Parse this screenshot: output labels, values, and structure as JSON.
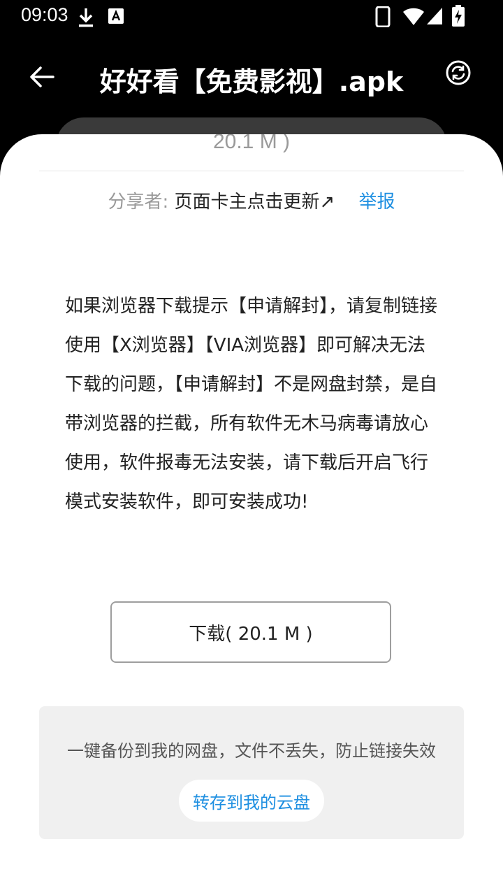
{
  "status_bar": {
    "time": "09:03",
    "icons": [
      "download-icon",
      "font-a-icon",
      "phone-icon",
      "wifi-icon",
      "signal-icon",
      "battery-charging-icon"
    ]
  },
  "header": {
    "title": "好好看【免费影视】.apk",
    "back_icon": "back-arrow-icon",
    "refresh_icon": "refresh-icon"
  },
  "file": {
    "size_text": "20.1 M )"
  },
  "sharer": {
    "label": "分享者:",
    "name": "页面卡主点击更新↗",
    "report_label": "举报"
  },
  "notice": {
    "text": "如果浏览器下载提示【申请解封】，请复制链接使用【X浏览器】【VIA浏览器】即可解决无法下载的问题，【申请解封】不是网盘封禁，是自带浏览器的拦截，所有软件无木马病毒请放心使用，软件报毒无法安装，请下载后开启飞行模式安装软件，即可安装成功!"
  },
  "download": {
    "label": "下载( 20.1 M )"
  },
  "backup": {
    "text": "一键备份到我的网盘，文件不丢失，防止链接失效",
    "save_label": "转存到我的云盘"
  },
  "colors": {
    "accent": "#1e8fe1",
    "header_bg": "#000000",
    "sheet_bg": "#ffffff",
    "backup_bg": "#f0f0f0"
  }
}
